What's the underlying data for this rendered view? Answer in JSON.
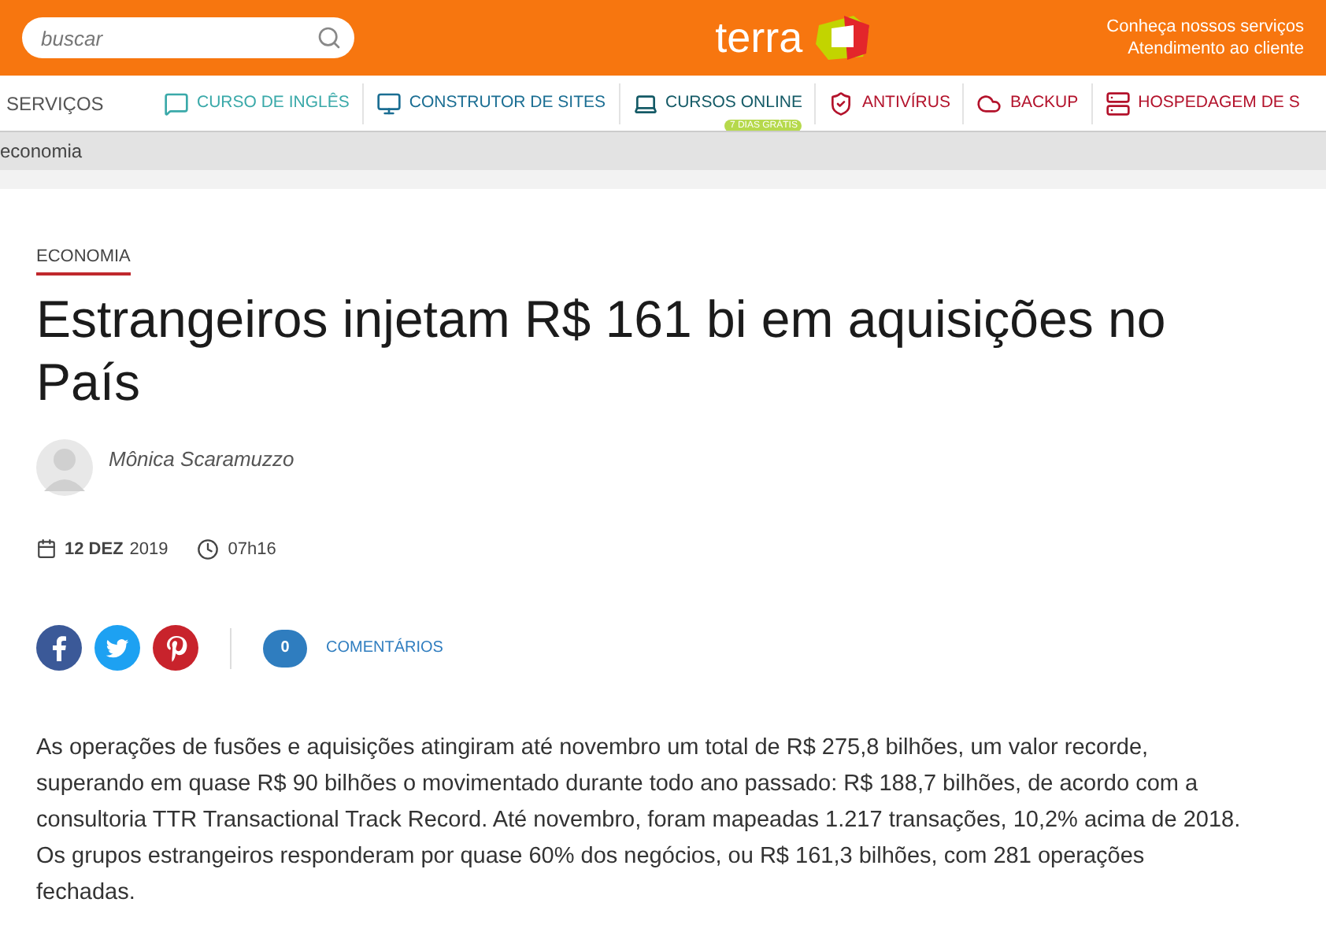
{
  "header": {
    "search": {
      "placeholder": "buscar"
    },
    "logo": "terra",
    "links": [
      "Conheça nossos serviços",
      "Atendimento ao cliente"
    ]
  },
  "nav": {
    "label": "SERVIÇOS",
    "items": [
      {
        "label": "CURSO DE INGLÊS",
        "kind": "chat",
        "color": "#3aa9a9"
      },
      {
        "label": "CONSTRUTOR DE SITES",
        "kind": "monitor",
        "color": "#1b6e93"
      },
      {
        "label": "CURSOS ONLINE",
        "kind": "laptop",
        "color": "#145a66",
        "badge": "7 DIAS GRÁTIS"
      },
      {
        "label": "ANTIVÍRUS",
        "kind": "shield",
        "color": "#b3122b"
      },
      {
        "label": "BACKUP",
        "kind": "cloud",
        "color": "#b3122b"
      },
      {
        "label": "HOSPEDAGEM DE S",
        "kind": "server",
        "color": "#b3122b"
      }
    ]
  },
  "breadcrumb": "economia",
  "article": {
    "section": "ECONOMIA",
    "title": "Estrangeiros injetam R$ 161 bi em aquisições no País",
    "author": "Mônica Scaramuzzo",
    "date_day": "12 DEZ",
    "date_year": "2019",
    "time": "07h16",
    "comments": {
      "count": "0",
      "label": "COMENTÁRIOS"
    },
    "body": "As operações de fusões e aquisições atingiram até novembro um total de R$ 275,8 bilhões, um valor recorde, superando em quase R$ 90 bilhões o movimentado durante todo ano passado: R$ 188,7 bilhões, de acordo com a consultoria TTR Transactional Track Record. Até novembro, foram mapeadas 1.217 transações, 10,2% acima de 2018. Os grupos estrangeiros responderam por quase 60% dos negócios, ou R$ 161,3 bilhões, com 281 operações fechadas."
  }
}
